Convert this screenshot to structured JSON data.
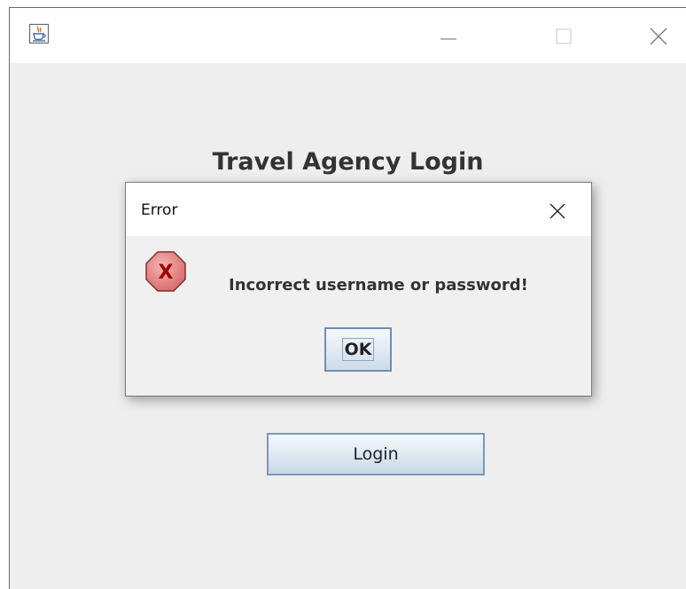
{
  "window": {
    "minimize_icon": "minimize-icon",
    "maximize_icon": "maximize-icon",
    "close_icon": "close-icon",
    "app_icon": "java-cup-icon"
  },
  "login": {
    "title": "Travel Agency Login",
    "login_button": "Login"
  },
  "dialog": {
    "title": "Error",
    "message": "Incorrect username or password!",
    "ok_button": "OK",
    "icon": "error-x-icon",
    "close_icon": "close-icon"
  },
  "colors": {
    "window_background": "#eeeeee",
    "error_icon_fill": "#e88585",
    "error_icon_x": "#b00000",
    "button_border": "#7a98b8"
  }
}
